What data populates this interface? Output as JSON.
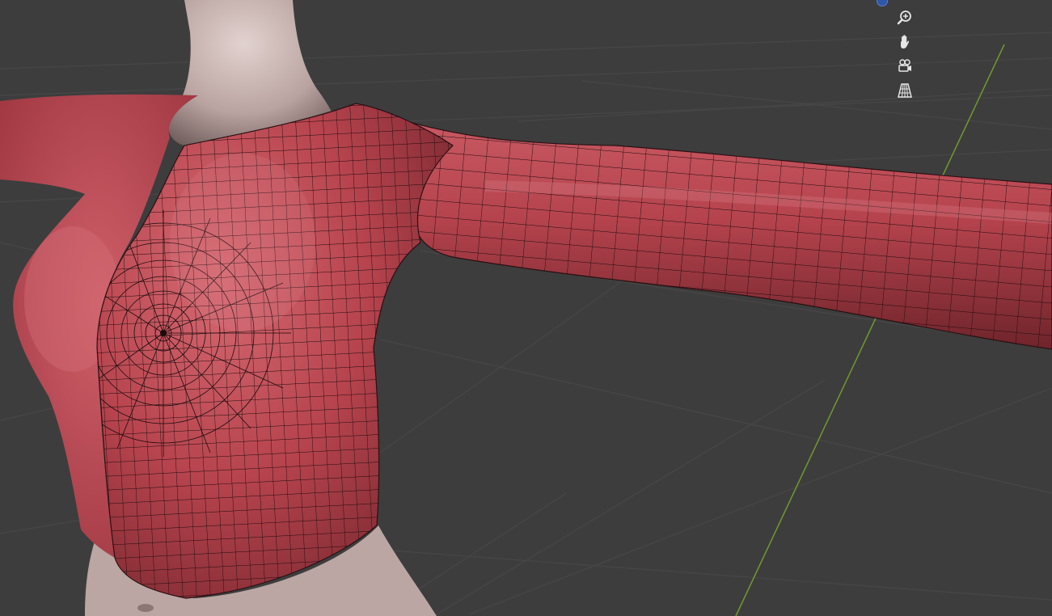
{
  "viewport": {
    "background_color": "#3d3d3d",
    "grid_color": "#474747",
    "y_axis_color": "#6f9a2e"
  },
  "navigation_gizmo": {
    "axis_indicator_color": "#2f56a8",
    "buttons": [
      {
        "name": "zoom-button",
        "icon": "zoom-in-icon"
      },
      {
        "name": "pan-button",
        "icon": "hand-icon"
      },
      {
        "name": "camera-view-button",
        "icon": "camera-icon"
      },
      {
        "name": "perspective-toggle-button",
        "icon": "grid-perspective-icon"
      }
    ]
  },
  "model": {
    "garment_color": "#b8454f",
    "skin_color": "#bfa8a5",
    "wireframe_color": "#1a0b0d"
  }
}
